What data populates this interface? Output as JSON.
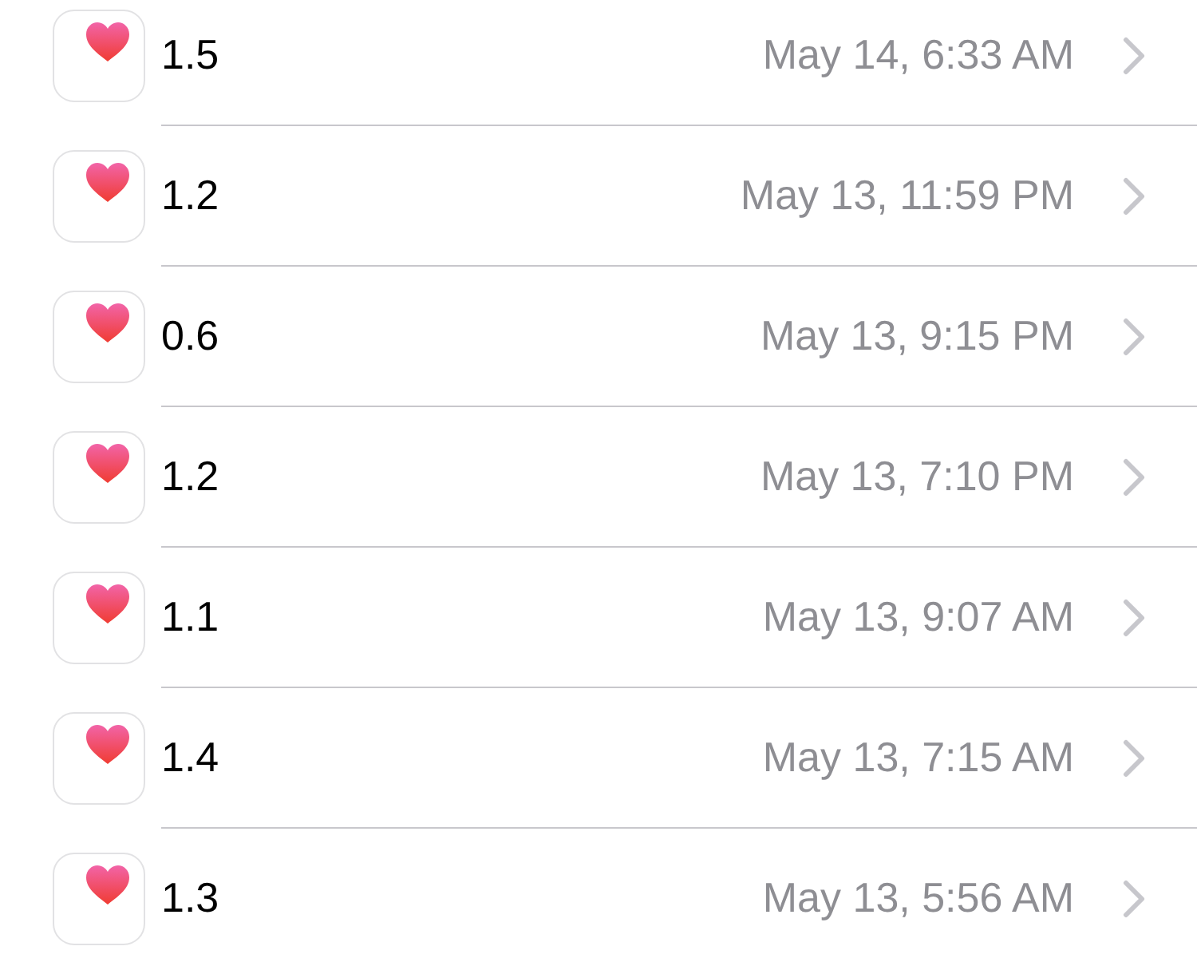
{
  "rows": [
    {
      "value": "1.5",
      "date": "May 14, 6:33 AM"
    },
    {
      "value": "1.2",
      "date": "May 13, 11:59 PM"
    },
    {
      "value": "0.6",
      "date": "May 13, 9:15 PM"
    },
    {
      "value": "1.2",
      "date": "May 13, 7:10 PM"
    },
    {
      "value": "1.1",
      "date": "May 13, 9:07 AM"
    },
    {
      "value": "1.4",
      "date": "May 13, 7:15 AM"
    },
    {
      "value": "1.3",
      "date": "May 13, 5:56 AM"
    }
  ]
}
